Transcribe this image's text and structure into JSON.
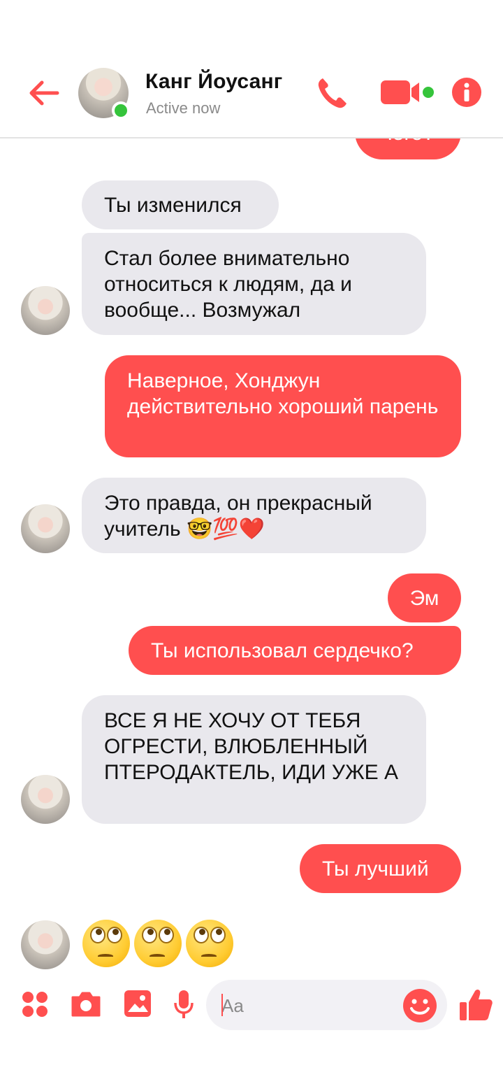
{
  "header": {
    "contact_name": "Канг Йоусанг",
    "status": "Active now"
  },
  "messages": [
    {
      "direction": "out",
      "text": "чего?"
    },
    {
      "direction": "in",
      "text": "Ты изменился"
    },
    {
      "direction": "in",
      "text": "Стал более внимательно относиться к людям, да и вообще... Возмужал"
    },
    {
      "direction": "out",
      "text": "Наверное, Хонджун действительно хороший парень"
    },
    {
      "direction": "in",
      "text": "Это правда, он прекрасный учитель 🤓💯❤️"
    },
    {
      "direction": "out",
      "text": "Эм"
    },
    {
      "direction": "out",
      "text": "Ты использовал сердечко?"
    },
    {
      "direction": "in",
      "text": "ВСЕ Я НЕ ХОЧУ ОТ ТЕБЯ ОГРЕСТИ, ВЛЮБЛЕННЫЙ ПТЕРОДАКТЕЛЬ, ИДИ УЖЕ А"
    },
    {
      "direction": "out",
      "text": "Ты лучший"
    },
    {
      "direction": "in",
      "text": "🙄🙄🙄"
    }
  ],
  "composer": {
    "placeholder": "Aa"
  },
  "colors": {
    "accent": "#ff4f4f",
    "incoming_bubble": "#e9e8ed",
    "online": "#35c43b"
  },
  "icons": [
    "back-arrow-icon",
    "phone-icon",
    "video-camera-icon",
    "info-icon",
    "apps-icon",
    "camera-icon",
    "image-icon",
    "microphone-icon",
    "emoji-icon",
    "thumbs-up-icon"
  ]
}
